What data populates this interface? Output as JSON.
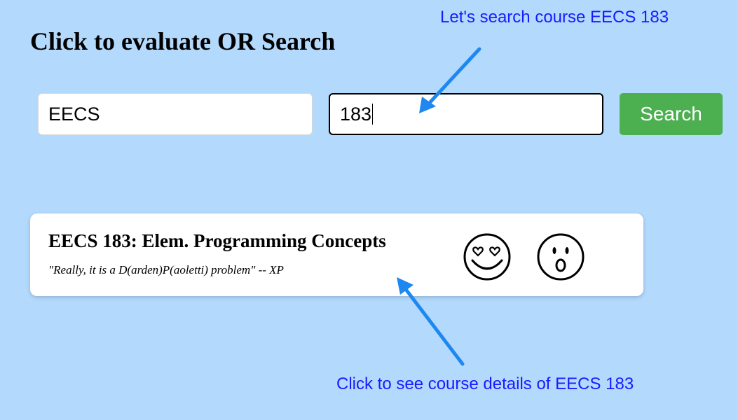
{
  "header": {
    "title": "Click to evaluate OR Search"
  },
  "search": {
    "department_value": "EECS",
    "number_value": "183",
    "button_label": "Search"
  },
  "result": {
    "course_title": "EECS 183: Elem. Programming Concepts",
    "quote": "\"Really, it is a D(arden)P(aoletti) problem\" -- XP",
    "reactions": [
      {
        "icon": "heart-eyes-smiley-icon"
      },
      {
        "icon": "surprised-face-icon"
      }
    ]
  },
  "annotations": {
    "top": "Let's search course EECS 183",
    "bottom": "Click to see course details of EECS 183",
    "color": "#1a1aff",
    "arrow_color": "#1e88f0"
  },
  "colors": {
    "background": "#b3d9fd",
    "search_button": "#4caf50"
  }
}
